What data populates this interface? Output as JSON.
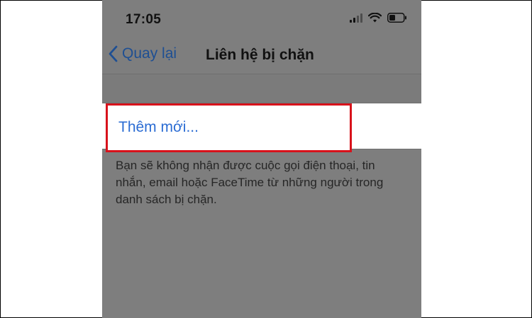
{
  "status_bar": {
    "time": "17:05",
    "icons": [
      "signal-icon",
      "wifi-icon",
      "battery-icon"
    ]
  },
  "nav": {
    "back_label": "Quay lại",
    "title": "Liên hệ bị chặn"
  },
  "list": {
    "add_new_label": "Thêm mới..."
  },
  "footnote": "Bạn sẽ không nhận được cuộc gọi điện thoại, tin nhắn, email hoặc FaceTime từ những người trong danh sách bị chặn.",
  "colors": {
    "accent": "#1e4f93",
    "link": "#2b6cd3",
    "highlight": "#d8121b",
    "overlay": "#7e7e7e"
  }
}
